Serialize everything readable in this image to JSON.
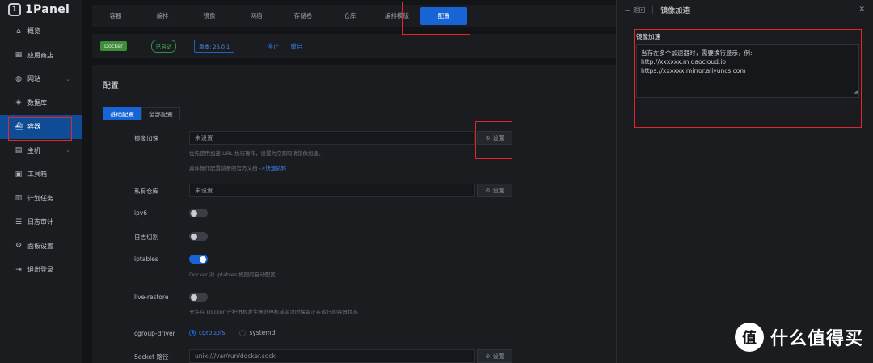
{
  "app": {
    "name": "1Panel"
  },
  "sidebar": {
    "items": [
      {
        "label": "概览",
        "icon": "home-icon"
      },
      {
        "label": "应用商店",
        "icon": "grid-icon"
      },
      {
        "label": "网站",
        "icon": "globe-icon",
        "chevron": true
      },
      {
        "label": "数据库",
        "icon": "layers-icon"
      },
      {
        "label": "容器",
        "icon": "docker-icon",
        "active": true
      },
      {
        "label": "主机",
        "icon": "server-icon",
        "chevron": true
      },
      {
        "label": "工具箱",
        "icon": "toolbox-icon"
      },
      {
        "label": "计划任务",
        "icon": "calendar-icon"
      },
      {
        "label": "日志审计",
        "icon": "log-icon"
      },
      {
        "label": "面板设置",
        "icon": "settings-icon"
      },
      {
        "label": "退出登录",
        "icon": "logout-icon"
      }
    ]
  },
  "topbar": {
    "tabs": [
      "容器",
      "编排",
      "镜像",
      "网络",
      "存储卷",
      "仓库",
      "编排模版",
      "配置"
    ],
    "active_index": 7
  },
  "status": {
    "docker_badge": "Docker",
    "running_badge": "已启动",
    "version_badge": "版本: 26.0.1",
    "stop_link": "停止",
    "restart_link": "重启"
  },
  "config": {
    "title": "配置",
    "tabs": [
      "基础配置",
      "全部配置"
    ],
    "mirror": {
      "label": "镜像加速",
      "value": "未设置",
      "button": "设置",
      "help1": "优先使用加速 URL 执行操作，设置为空则取消镜像加速。",
      "help2_prefix": "具体操作配置请参照官方文档",
      "help2_link": "->快速跳转"
    },
    "registry": {
      "label": "私有仓库",
      "value": "未设置",
      "button": "设置"
    },
    "ipv6": {
      "label": "ipv6",
      "on": false
    },
    "log_cut": {
      "label": "日志切割",
      "on": false
    },
    "iptables": {
      "label": "iptables",
      "on": true,
      "help": "Docker 对 iptables 规则的自动配置"
    },
    "live_restore": {
      "label": "live-restore",
      "on": false,
      "help": "允许在 Docker 守护进程发生意外停机或崩溃时保留正在运行的容器状态"
    },
    "cgroup": {
      "label": "cgroup-driver",
      "options": [
        "cgroupfs",
        "systemd"
      ],
      "selected": "cgroupfs"
    },
    "socket": {
      "label": "Socket 路径",
      "value": "unix:///var/run/docker.sock",
      "button": "设置"
    }
  },
  "drawer": {
    "back": "返回",
    "title": "镜像加速",
    "field_label": "镜像加速",
    "textarea_lines": [
      "当存在多个加速器时，需要换行显示，例:",
      "http://xxxxxx.m.daocloud.io",
      "https://xxxxxx.mirror.aliyuncs.com"
    ]
  },
  "watermark": {
    "icon_text": "值",
    "text": "什么值得买"
  },
  "colors": {
    "accent": "#1664d6",
    "highlight": "#e3262b",
    "background": "#121417"
  }
}
